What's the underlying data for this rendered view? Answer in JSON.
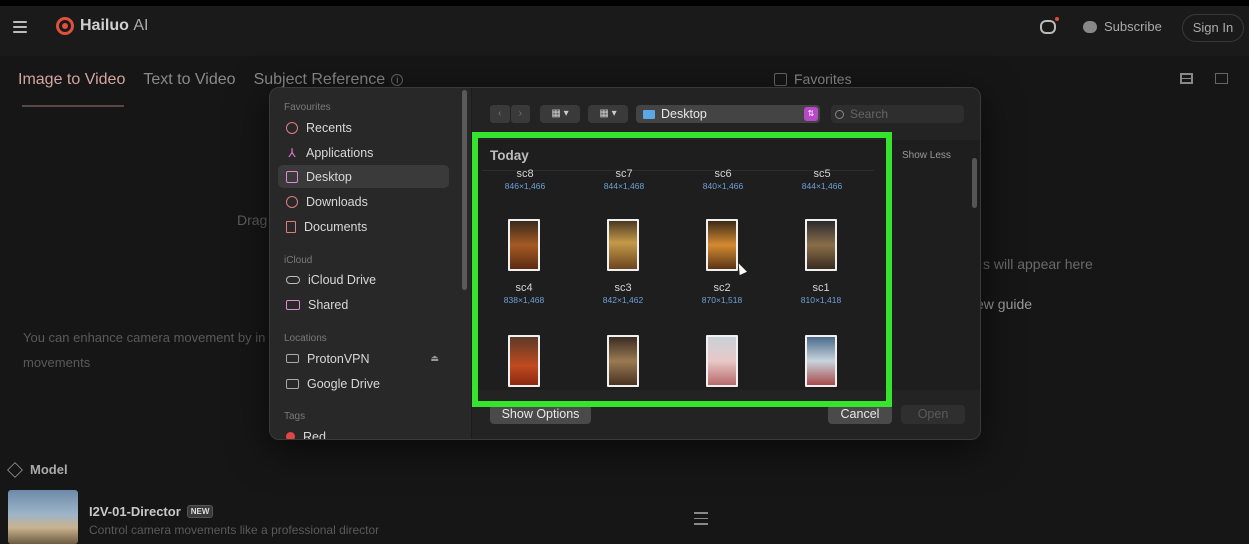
{
  "app": {
    "logo": "Hailuo",
    "logo_suffix": "AI"
  },
  "header": {
    "subscribe": "Subscribe",
    "sign_in": "Sign In"
  },
  "tabs": [
    {
      "label": "Image to Video",
      "active": true
    },
    {
      "label": "Text to Video",
      "active": false
    },
    {
      "label": "Subject Reference",
      "active": false
    }
  ],
  "right_panel": {
    "favorites": "Favorites",
    "empty_text": "s will appear here",
    "guide": "ew guide"
  },
  "upload": {
    "drag": "Drag",
    "hint": "You can enhance camera movement by in camera movements"
  },
  "model": {
    "section": "Model",
    "name": "I2V-01-Director",
    "badge": "NEW",
    "desc": "Control camera movements like a professional director"
  },
  "dialog": {
    "sidebar": {
      "favourites_header": "Favourites",
      "favourites": [
        "Recents",
        "Applications",
        "Desktop",
        "Downloads",
        "Documents"
      ],
      "selected": "Desktop",
      "icloud_header": "iCloud",
      "icloud": [
        "iCloud Drive",
        "Shared"
      ],
      "locations_header": "Locations",
      "locations": [
        "ProtonVPN",
        "Google Drive"
      ],
      "tags_header": "Tags",
      "tags": [
        "Red"
      ]
    },
    "toolbar": {
      "location": "Desktop",
      "search_placeholder": "Search"
    },
    "content": {
      "group": "Today",
      "show_less": "Show Less",
      "row1": [
        {
          "name": "sc8",
          "dims": "846×1,466"
        },
        {
          "name": "sc7",
          "dims": "844×1,468"
        },
        {
          "name": "sc6",
          "dims": "840×1,466"
        },
        {
          "name": "sc5",
          "dims": "844×1,466"
        }
      ],
      "row2": [
        {
          "name": "sc4",
          "dims": "838×1,468"
        },
        {
          "name": "sc3",
          "dims": "842×1,462"
        },
        {
          "name": "sc2",
          "dims": "870×1,518"
        },
        {
          "name": "sc1",
          "dims": "810×1,418"
        }
      ]
    },
    "footer": {
      "show_options": "Show Options",
      "cancel": "Cancel",
      "open": "Open"
    },
    "colors": {
      "highlight": "#36e42d",
      "dims": "#6ea0d6"
    }
  }
}
